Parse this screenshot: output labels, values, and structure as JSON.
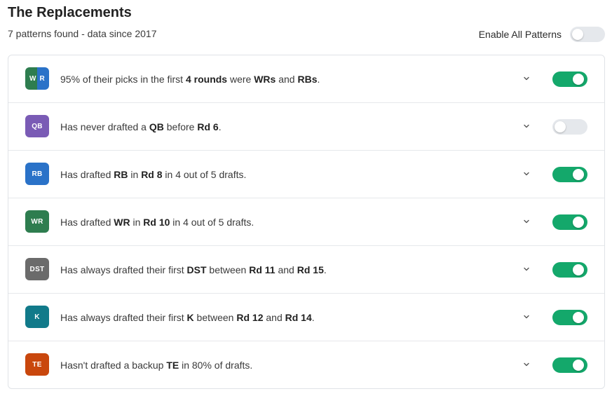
{
  "header": {
    "title": "The Replacements",
    "subtitle": "7 patterns found - data since 2017",
    "enable_all_label": "Enable All Patterns",
    "enable_all_on": false
  },
  "colors": {
    "toggle_on": "#14a86b",
    "toggle_off": "#e5e8ec",
    "wr": "#2e7d4f",
    "rb": "#2a72c8",
    "qb": "#7a5bb5",
    "dst": "#6b6b6b",
    "k": "#117a8a",
    "te": "#c9470d"
  },
  "patterns": [
    {
      "badge_left": "W",
      "badge_right": "R",
      "text": [
        {
          "t": "95% of their picks in the first ",
          "b": false
        },
        {
          "t": "4 rounds",
          "b": true
        },
        {
          "t": " were ",
          "b": false
        },
        {
          "t": "WRs",
          "b": true
        },
        {
          "t": " and ",
          "b": false
        },
        {
          "t": "RBs",
          "b": true
        },
        {
          "t": ".",
          "b": false
        }
      ],
      "enabled": true,
      "chevron_icon": "chevron-down-icon"
    },
    {
      "badge": "QB",
      "text": [
        {
          "t": "Has never drafted a ",
          "b": false
        },
        {
          "t": "QB",
          "b": true
        },
        {
          "t": " before ",
          "b": false
        },
        {
          "t": "Rd 6",
          "b": true
        },
        {
          "t": ".",
          "b": false
        }
      ],
      "enabled": false,
      "chevron_icon": "chevron-down-icon"
    },
    {
      "badge": "RB",
      "text": [
        {
          "t": "Has drafted ",
          "b": false
        },
        {
          "t": "RB",
          "b": true
        },
        {
          "t": " in ",
          "b": false
        },
        {
          "t": "Rd 8",
          "b": true
        },
        {
          "t": " in 4 out of 5 drafts.",
          "b": false
        }
      ],
      "enabled": true,
      "chevron_icon": "chevron-down-icon"
    },
    {
      "badge": "WR",
      "text": [
        {
          "t": "Has drafted ",
          "b": false
        },
        {
          "t": "WR",
          "b": true
        },
        {
          "t": " in ",
          "b": false
        },
        {
          "t": "Rd 10",
          "b": true
        },
        {
          "t": " in 4 out of 5 drafts.",
          "b": false
        }
      ],
      "enabled": true,
      "chevron_icon": "chevron-down-icon"
    },
    {
      "badge": "DST",
      "text": [
        {
          "t": "Has always drafted their first ",
          "b": false
        },
        {
          "t": "DST",
          "b": true
        },
        {
          "t": " between ",
          "b": false
        },
        {
          "t": "Rd 11",
          "b": true
        },
        {
          "t": " and ",
          "b": false
        },
        {
          "t": "Rd 15",
          "b": true
        },
        {
          "t": ".",
          "b": false
        }
      ],
      "enabled": true,
      "chevron_icon": "chevron-down-icon"
    },
    {
      "badge": "K",
      "text": [
        {
          "t": "Has always drafted their first ",
          "b": false
        },
        {
          "t": "K",
          "b": true
        },
        {
          "t": " between ",
          "b": false
        },
        {
          "t": "Rd 12",
          "b": true
        },
        {
          "t": " and ",
          "b": false
        },
        {
          "t": "Rd 14",
          "b": true
        },
        {
          "t": ".",
          "b": false
        }
      ],
      "enabled": true,
      "chevron_icon": "chevron-down-icon"
    },
    {
      "badge": "TE",
      "text": [
        {
          "t": "Hasn't drafted a backup ",
          "b": false
        },
        {
          "t": "TE",
          "b": true
        },
        {
          "t": " in 80% of drafts.",
          "b": false
        }
      ],
      "enabled": true,
      "chevron_icon": "chevron-down-icon"
    }
  ]
}
